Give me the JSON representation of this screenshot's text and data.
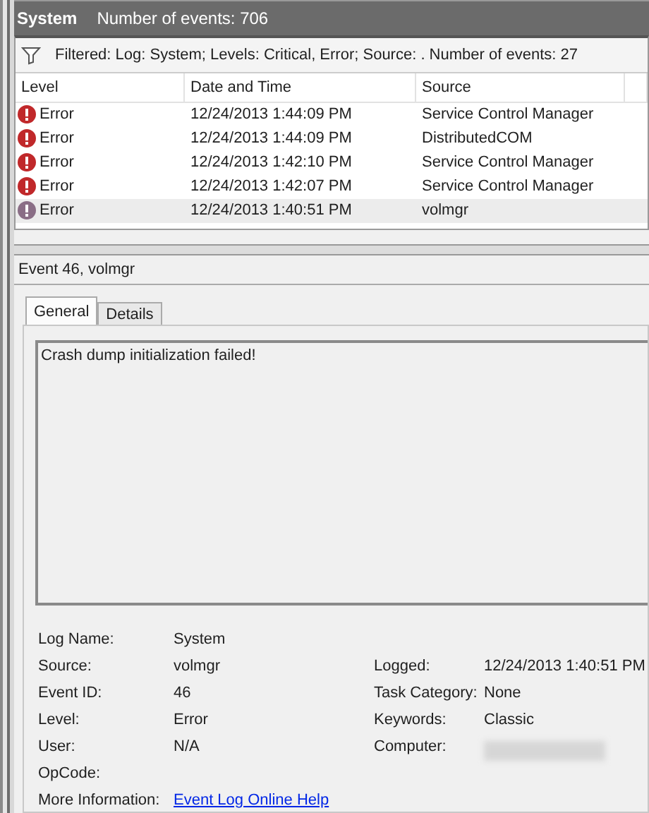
{
  "header": {
    "log": "System",
    "count": "Number of events: 706"
  },
  "filter": {
    "text": "Filtered: Log: System; Levels: Critical, Error; Source: . Number of events: 27"
  },
  "table": {
    "columns": [
      "Level",
      "Date and Time",
      "Source"
    ],
    "rows": [
      {
        "level": "Error",
        "date": "12/24/2013 1:44:09 PM",
        "source": "Service Control Manager",
        "selected": false
      },
      {
        "level": "Error",
        "date": "12/24/2013 1:44:09 PM",
        "source": "DistributedCOM",
        "selected": false
      },
      {
        "level": "Error",
        "date": "12/24/2013 1:42:10 PM",
        "source": "Service Control Manager",
        "selected": false
      },
      {
        "level": "Error",
        "date": "12/24/2013 1:42:07 PM",
        "source": "Service Control Manager",
        "selected": false
      },
      {
        "level": "Error",
        "date": "12/24/2013 1:40:51 PM",
        "source": "volmgr",
        "selected": true
      }
    ]
  },
  "event": {
    "title": "Event 46, volmgr",
    "tabs": [
      {
        "label": "General",
        "selected": true
      },
      {
        "label": "Details",
        "selected": false
      }
    ],
    "message": "Crash dump initialization failed!",
    "fields": [
      {
        "left": {
          "label": "Log Name:",
          "value": "System"
        }
      },
      {
        "left": {
          "label": "Source:",
          "value": "volmgr"
        },
        "right": {
          "label": "Logged:",
          "value": "12/24/2013 1:40:51 PM"
        }
      },
      {
        "left": {
          "label": "Event ID:",
          "value": "46"
        },
        "right": {
          "label": "Task Category:",
          "value": "None"
        }
      },
      {
        "left": {
          "label": "Level:",
          "value": "Error"
        },
        "right": {
          "label": "Keywords:",
          "value": "Classic"
        }
      },
      {
        "left": {
          "label": "User:",
          "value": "N/A"
        },
        "right": {
          "label": "Computer:",
          "redacted": true
        }
      },
      {
        "left": {
          "label": "OpCode:"
        }
      },
      {
        "left": {
          "label": "More Information:",
          "link": "Event Log Online Help"
        }
      }
    ]
  }
}
